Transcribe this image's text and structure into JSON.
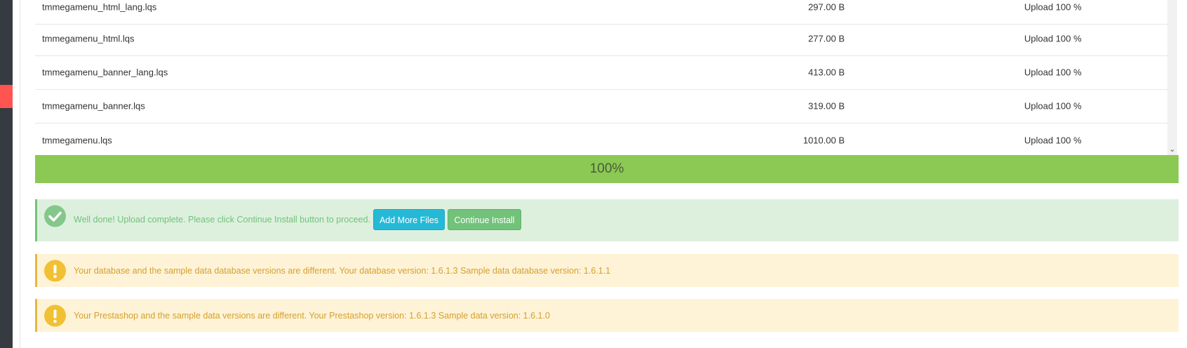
{
  "files": [
    {
      "name": "tmmegamenu_html_lang.lqs",
      "size": "297.00 B",
      "status": "Upload 100 %"
    },
    {
      "name": "tmmegamenu_html.lqs",
      "size": "277.00 B",
      "status": "Upload 100 %"
    },
    {
      "name": "tmmegamenu_banner_lang.lqs",
      "size": "413.00 B",
      "status": "Upload 100 %"
    },
    {
      "name": "tmmegamenu_banner.lqs",
      "size": "319.00 B",
      "status": "Upload 100 %"
    },
    {
      "name": "tmmegamenu.lqs",
      "size": "1010.00 B",
      "status": "Upload 100 %"
    }
  ],
  "progress": {
    "label": "100%",
    "value": 1.0
  },
  "success": {
    "message": "Well done! Upload complete. Please click Continue Install button to proceed.",
    "add_more_label": "Add More Files",
    "continue_label": "Continue Install"
  },
  "warnings": [
    {
      "message": "Your database and the sample data database versions are different. Your database version: 1.6.1.3 Sample data database version: 1.6.1.1"
    },
    {
      "message": "Your Prestashop and the sample data versions are different. Your Prestashop version: 1.6.1.3 Sample data version: 1.6.1.0"
    }
  ],
  "icons": {
    "success": "check-circle-icon",
    "warning": "exclamation-circle-icon",
    "scroll": "chevron-down-icon"
  },
  "colors": {
    "progress": "#8bc954",
    "success_bg": "#ddf0de",
    "warning_bg": "#fff3d7",
    "info_button": "#25b9d7",
    "success_button": "#72c279",
    "sidebar": "#363a41",
    "sidebar_accent": "#ff5450"
  }
}
